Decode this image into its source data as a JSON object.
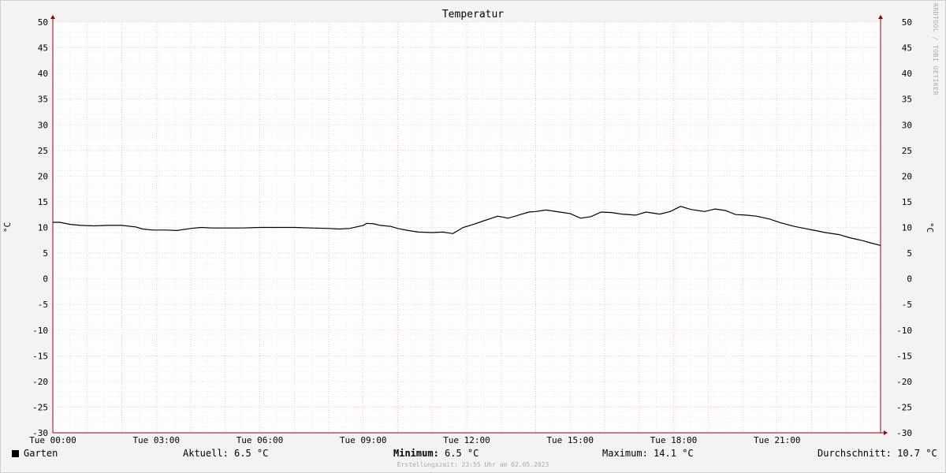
{
  "chart_data": {
    "type": "line",
    "title": "Temperatur",
    "ylabel": "°C",
    "ylim": [
      -30,
      50
    ],
    "y_ticks": [
      "50",
      "45",
      "40",
      "35",
      "30",
      "25",
      "20",
      "15",
      "10",
      "5",
      "0",
      "-5",
      "-10",
      "-15",
      "-20",
      "-25",
      "-30"
    ],
    "xlim": [
      0,
      24
    ],
    "x_ticks": [
      {
        "hour": 0,
        "label": "Tue 00:00"
      },
      {
        "hour": 3,
        "label": "Tue 03:00"
      },
      {
        "hour": 6,
        "label": "Tue 06:00"
      },
      {
        "hour": 9,
        "label": "Tue 09:00"
      },
      {
        "hour": 12,
        "label": "Tue 12:00"
      },
      {
        "hour": 15,
        "label": "Tue 15:00"
      },
      {
        "hour": 18,
        "label": "Tue 18:00"
      },
      {
        "hour": 21,
        "label": "Tue 21:00"
      }
    ],
    "grid": true,
    "series": [
      {
        "name": "Garten",
        "color": "#000000",
        "x": [
          0,
          0.2,
          0.5,
          0.8,
          1.2,
          1.6,
          2.0,
          2.4,
          2.6,
          2.9,
          3.3,
          3.6,
          4.0,
          4.3,
          4.6,
          5.0,
          5.5,
          6.0,
          6.5,
          7.0,
          7.5,
          8.0,
          8.3,
          8.6,
          9.0,
          9.1,
          9.3,
          9.5,
          9.8,
          10.0,
          10.3,
          10.6,
          11.0,
          11.3,
          11.6,
          11.9,
          12.2,
          12.5,
          12.9,
          13.2,
          13.5,
          13.8,
          14.0,
          14.3,
          14.7,
          15.0,
          15.3,
          15.6,
          15.9,
          16.2,
          16.5,
          16.9,
          17.2,
          17.6,
          17.9,
          18.2,
          18.5,
          18.9,
          19.2,
          19.5,
          19.8,
          20.1,
          20.4,
          20.8,
          21.1,
          21.5,
          21.8,
          22.1,
          22.4,
          22.8,
          23.1,
          23.5,
          23.7,
          24.0
        ],
        "values": [
          11.0,
          11.0,
          10.6,
          10.4,
          10.3,
          10.4,
          10.4,
          10.1,
          9.7,
          9.5,
          9.5,
          9.4,
          9.8,
          10.0,
          9.9,
          9.9,
          9.9,
          10.0,
          10.0,
          10.0,
          9.9,
          9.8,
          9.7,
          9.8,
          10.4,
          10.8,
          10.7,
          10.4,
          10.2,
          9.8,
          9.4,
          9.1,
          9.0,
          9.1,
          8.8,
          10.0,
          10.6,
          11.3,
          12.2,
          11.8,
          12.4,
          13.0,
          13.1,
          13.4,
          13.0,
          12.7,
          11.8,
          12.1,
          13.0,
          12.9,
          12.6,
          12.4,
          13.0,
          12.6,
          13.1,
          14.1,
          13.5,
          13.1,
          13.6,
          13.3,
          12.5,
          12.4,
          12.2,
          11.6,
          10.9,
          10.2,
          9.8,
          9.4,
          9.0,
          8.6,
          8.0,
          7.4,
          7.0,
          6.5
        ]
      }
    ]
  },
  "legend": {
    "series_name": "Garten",
    "aktuell": "Aktuell: 6.5 °C",
    "minimum_label": "Minimum:",
    "minimum_value": " 6.5 °C",
    "maximum": "Maximum: 14.1 °C",
    "durchschnitt": "Durchschnitt: 10.7 °C"
  },
  "footer": "Erstellungszeit: 23:55 Uhr am 02.05.2023",
  "watermark": "RRDTOOL / TOBI OETIKER",
  "colors": {
    "grid_major": "#f0a0a0",
    "grid_minor": "#d8d8d8",
    "axis_arrow": "#a00000",
    "line": "#000000"
  }
}
